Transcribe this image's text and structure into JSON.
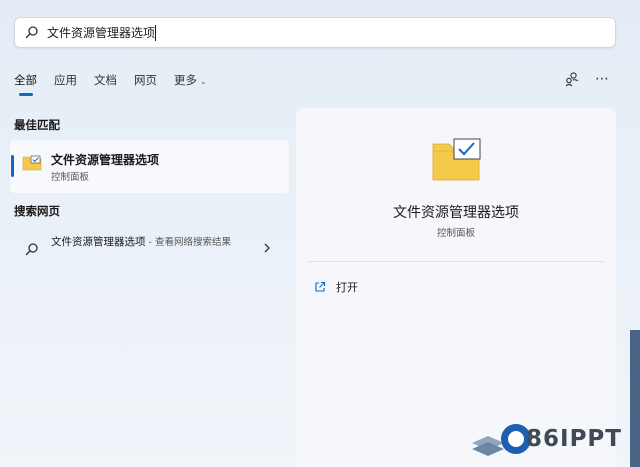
{
  "search": {
    "value": "文件资源管理器选项"
  },
  "tabs": [
    {
      "label": "全部"
    },
    {
      "label": "应用"
    },
    {
      "label": "文档"
    },
    {
      "label": "网页"
    },
    {
      "label": "更多"
    }
  ],
  "best_match": {
    "title": "最佳匹配",
    "item": {
      "name": "文件资源管理器选项",
      "subtitle": "控制面板"
    }
  },
  "web_search": {
    "title": "搜索网页",
    "item": {
      "text": "文件资源管理器选项",
      "hint": " - 查看网络搜索结果"
    }
  },
  "detail": {
    "title": "文件资源管理器选项",
    "subtitle": "控制面板",
    "actions": [
      {
        "label": "打开",
        "icon": "open-external-icon"
      }
    ]
  },
  "watermark": {
    "text": "86IPPT"
  },
  "colors": {
    "accent": "#1565c8",
    "folder": "#f5c94a",
    "folder_dark": "#e8b530"
  }
}
